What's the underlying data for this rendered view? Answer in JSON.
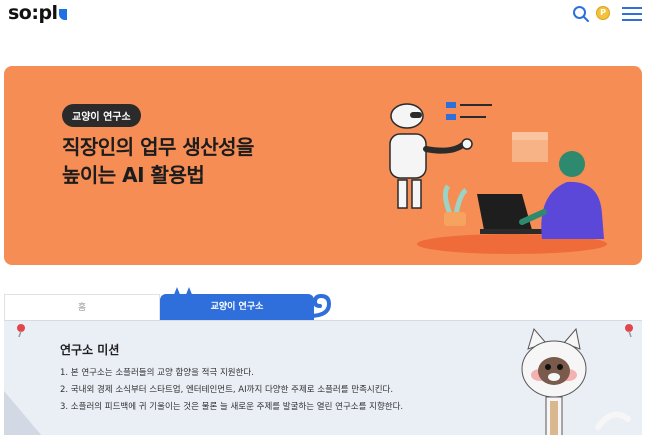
{
  "header": {
    "logo": "so:pl",
    "icons": [
      "search-icon",
      "coin-icon",
      "menu-icon"
    ],
    "coin_label": "P"
  },
  "banner": {
    "tag": "교양이 연구소",
    "title_line1": "직장인의 업무 생산성을",
    "title_line2": "높이는 AI 활용법",
    "background": "#f58d55"
  },
  "tabs": {
    "home": "홈",
    "active": "교양이 연구소"
  },
  "mission": {
    "title": "연구소 미션",
    "items": [
      "1. 본 연구소는 소플러들의 교양 함양을 적극 지원한다.",
      "2. 국내외 경제 소식부터 스타트업, 엔터테인먼트, AI까지 다양한 주제로 소플러를 만족시킨다.",
      "3. 소플러의 피드백에 귀 기울이는 것은 물론 늘 새로운 주제를 발굴하는 열린 연구소를 지향한다."
    ]
  },
  "colors": {
    "accent": "#2e6fdc",
    "banner": "#f58d55",
    "panel": "#eaeef5"
  }
}
